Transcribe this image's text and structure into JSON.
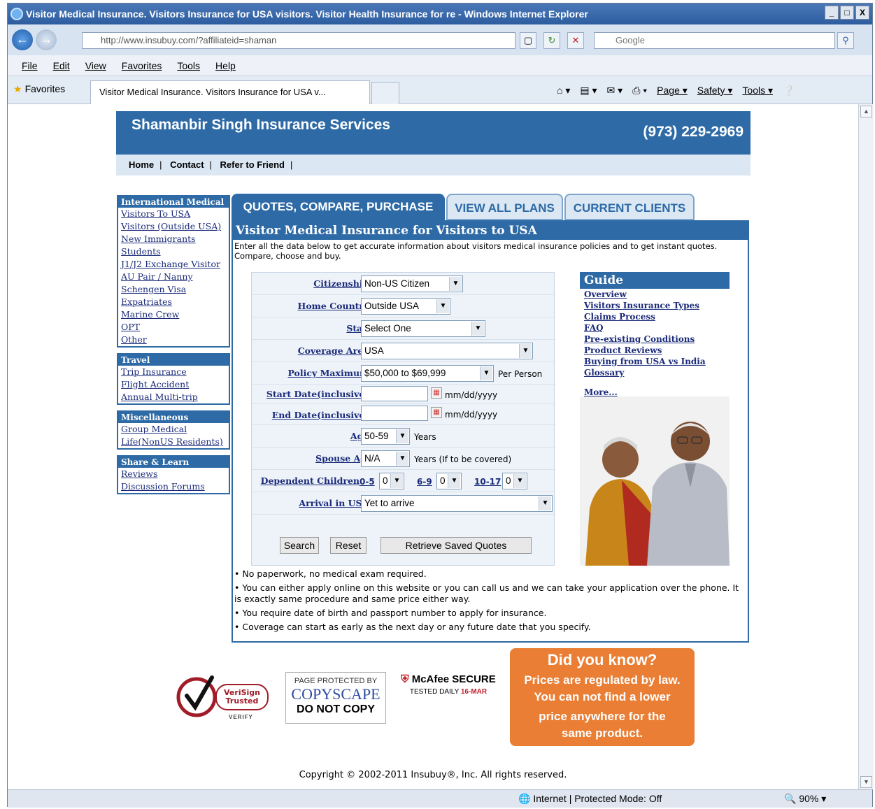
{
  "browser": {
    "title": "Visitor Medical Insurance. Visitors Insurance for USA visitors. Visitor Health Insurance for re - Windows Internet Explorer",
    "window_buttons": [
      "_",
      "□",
      "X"
    ],
    "url": "http://www.insubuy.com/?affiliateid=shaman",
    "search_placeholder": "Google",
    "menu": [
      "File",
      "Edit",
      "View",
      "Favorites",
      "Tools",
      "Help"
    ],
    "favorites_label": "Favorites",
    "tab_title": "Visitor Medical Insurance. Visitors Insurance for USA v...",
    "commands": [
      "Page ▾",
      "Safety ▾",
      "Tools ▾"
    ],
    "status_zone": "Internet | Protected Mode: Off",
    "zoom": "90%"
  },
  "site": {
    "name": "Shamanbir Singh Insurance Services",
    "phone": "(973) 229-2969",
    "topnav": [
      "Home",
      "Contact",
      "Refer to Friend"
    ]
  },
  "leftnav": [
    {
      "heading": "International Medical",
      "links": [
        "Visitors To USA",
        "Visitors (Outside USA)",
        "New Immigrants",
        "Students",
        "J1/J2 Exchange Visitor",
        "AU Pair / Nanny",
        "Schengen Visa",
        "Expatriates",
        "Marine Crew",
        "OPT",
        "Other"
      ]
    },
    {
      "heading": "Travel",
      "links": [
        "Trip Insurance",
        "Flight Accident",
        "Annual Multi-trip"
      ]
    },
    {
      "heading": "Miscellaneous",
      "links": [
        "Group Medical",
        "Life(NonUS Residents)"
      ]
    },
    {
      "heading": "Share & Learn",
      "links": [
        "Reviews",
        "Discussion Forums"
      ]
    }
  ],
  "tabs": [
    "QUOTES, COMPARE, PURCHASE",
    "VIEW ALL PLANS",
    "CURRENT CLIENTS"
  ],
  "panel": {
    "title": "Visitor Medical Insurance for Visitors to USA",
    "intro": "Enter all the data below to get accurate information about visitors medical insurance policies and to get instant quotes. Compare, choose and buy."
  },
  "form": {
    "citizenship": {
      "label": "Citizenship",
      "value": "Non-US Citizen"
    },
    "home_country": {
      "label": "Home Country",
      "value": "Outside USA"
    },
    "state": {
      "label": "State",
      "value": "Select One"
    },
    "coverage_area": {
      "label": "Coverage Area",
      "value": "USA"
    },
    "policy_max": {
      "label": "Policy Maximum",
      "value": "$50,000 to $69,999",
      "after": "Per Person"
    },
    "start_date": {
      "label": "Start Date(inclusive)",
      "hint": "mm/dd/yyyy"
    },
    "end_date": {
      "label": "End Date(inclusive)",
      "hint": "mm/dd/yyyy"
    },
    "age": {
      "label": "Age",
      "value": "50-59",
      "after": "Years"
    },
    "spouse_age": {
      "label": "Spouse Age",
      "value": "N/A",
      "after": "Years (If to be covered)"
    },
    "dependents": {
      "label": "Dependent Children",
      "g1": "0-5",
      "v1": "0",
      "g2": "6-9",
      "v2": "0",
      "g3": "10-17",
      "v3": "0"
    },
    "arrival": {
      "label": "Arrival in USA",
      "value": "Yet to arrive"
    },
    "buttons": {
      "search": "Search",
      "reset": "Reset",
      "retrieve": "Retrieve Saved Quotes"
    }
  },
  "guide": {
    "title": "Guide",
    "links": [
      "Overview",
      "Visitors Insurance Types",
      "Claims Process",
      "FAQ",
      "Pre-existing Conditions",
      "Product Reviews",
      "Buying from USA vs India",
      "Glossary"
    ],
    "more": "More..."
  },
  "bullets": [
    "• No paperwork, no medical exam required.",
    "• You can either apply online on this website or you can call us and we can take your application over the phone. It is exactly same procedure and same price either way.",
    "• You require date of birth and passport number to apply for insurance.",
    "• Coverage can start as early as the next day or any future date that you specify."
  ],
  "badges": {
    "verisign": "VeriSign Trusted",
    "verify": "VERIFY",
    "copyscape_top": "PAGE PROTECTED BY",
    "copyscape_name": "COPYSCAPE",
    "copyscape_bottom": "DO NOT COPY",
    "mcafee": "McAfee SECURE",
    "mcafee_sub": "TESTED DAILY",
    "mcafee_date": "16-MAR"
  },
  "didyouknow": {
    "title": "Did you know?",
    "l1": "Prices are regulated by law.",
    "l2": "You can not find a lower",
    "l3": "price anywhere for the",
    "l4": "same product."
  },
  "copyright": "Copyright © 2002-2011 Insubuy®, Inc.   All rights reserved."
}
